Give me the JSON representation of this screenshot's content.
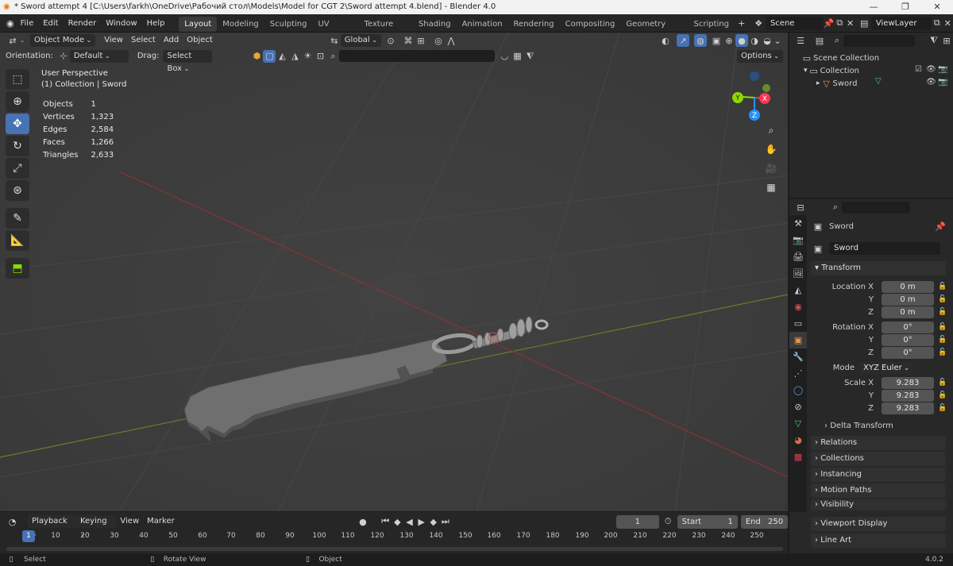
{
  "window": {
    "title": "* Sword attempt 4 [C:\\Users\\farkh\\OneDrive\\Рабочий стол\\Models\\Model for CGT 2\\Sword attempt 4.blend] - Blender 4.0"
  },
  "menu": [
    "File",
    "Edit",
    "Render",
    "Window",
    "Help"
  ],
  "workspaces": [
    "Layout",
    "Modeling",
    "Sculpting",
    "UV Editing",
    "Texture Paint",
    "Shading",
    "Animation",
    "Rendering",
    "Compositing",
    "Geometry Nodes",
    "Scripting"
  ],
  "active_workspace": "Layout",
  "scene": "Scene",
  "view_layer": "ViewLayer",
  "viewport": {
    "mode": "Object Mode",
    "menus": [
      "View",
      "Select",
      "Add",
      "Object"
    ],
    "orientation_global": "Global",
    "orientation_label": "Orientation:",
    "orientation_value": "Default",
    "drag_label": "Drag:",
    "drag_value": "Select Box",
    "options": "Options",
    "view_name": "User Perspective",
    "collection_line": "(1) Collection | Sword",
    "stats": [
      {
        "label": "Objects",
        "value": "1"
      },
      {
        "label": "Vertices",
        "value": "1,323"
      },
      {
        "label": "Edges",
        "value": "2,584"
      },
      {
        "label": "Faces",
        "value": "1,266"
      },
      {
        "label": "Triangles",
        "value": "2,633"
      }
    ],
    "gizmo": {
      "x": "X",
      "y": "Y",
      "z": "Z"
    }
  },
  "outliner": {
    "root": "Scene Collection",
    "collection": "Collection",
    "object": "Sword"
  },
  "properties": {
    "object_name": "Sword",
    "data_name": "Sword",
    "transform": "Transform",
    "location_label": "Location X",
    "location": [
      "0 m",
      "0 m",
      "0 m"
    ],
    "rotation_label": "Rotation X",
    "rotation": [
      "0°",
      "0°",
      "0°"
    ],
    "mode_label": "Mode",
    "mode": "XYZ Euler",
    "scale_label": "Scale X",
    "scale": [
      "9.283",
      "9.283",
      "9.283"
    ],
    "axis_y": "Y",
    "axis_z": "Z",
    "delta": "Delta Transform",
    "sections": [
      "Relations",
      "Collections",
      "Instancing",
      "Motion Paths",
      "Visibility",
      "Viewport Display",
      "Line Art"
    ]
  },
  "timeline": {
    "menus": [
      "Playback",
      "Keying",
      "View",
      "Marker"
    ],
    "current_frame": "1",
    "start_label": "Start",
    "start": "1",
    "end_label": "End",
    "end": "250",
    "ticks": [
      "1",
      "10",
      "20",
      "30",
      "40",
      "50",
      "60",
      "70",
      "80",
      "90",
      "100",
      "110",
      "120",
      "130",
      "140",
      "150",
      "160",
      "170",
      "180",
      "190",
      "200",
      "210",
      "220",
      "230",
      "240",
      "250"
    ]
  },
  "statusbar": {
    "select": "Select",
    "rotate": "Rotate View",
    "object": "Object",
    "version": "4.0.2"
  },
  "colors": {
    "accent": "#4772b3",
    "x_axis": "#ff3352",
    "y_axis": "#8bdc00",
    "z_axis": "#2890ff"
  }
}
